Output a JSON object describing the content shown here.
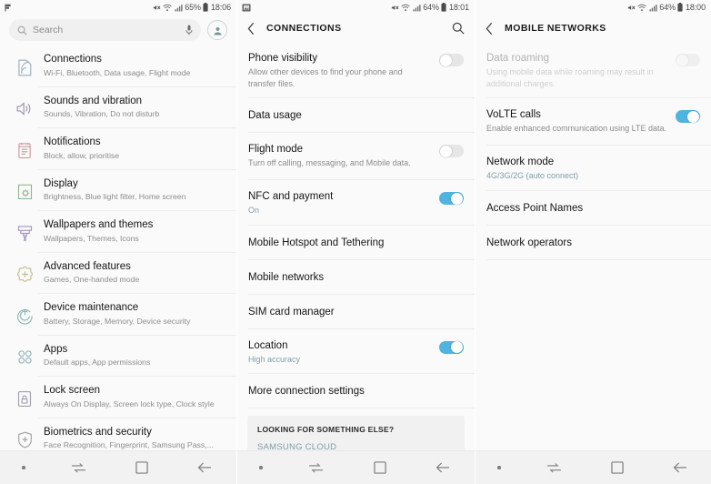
{
  "colors": {
    "accent_on": "#4fb4e0",
    "accent_link": "#7fa0a8",
    "bg": "#fafafa",
    "card_bg": "#f1f1f1",
    "title": "#151515",
    "subtitle": "#8c8c8c"
  },
  "panel1": {
    "statusbar": {
      "left_icons": [
        "flag-notification-icon"
      ],
      "mute_icon": "sound-mute-icon",
      "wifi_icon": "wifi-icon",
      "signal_icon": "signal-bars-icon",
      "battery_text": "65%",
      "battery_icon": "battery-icon",
      "time": "18:06"
    },
    "search": {
      "placeholder": "Search",
      "search_icon": "search-icon",
      "mic_icon": "microphone-icon",
      "avatar_icon": "account-avatar-icon"
    },
    "items": [
      {
        "icon": "connections-icon",
        "icon_color": "#9badbd",
        "title": "Connections",
        "subtitle": "Wi-Fi, Bluetooth, Data usage, Flight mode"
      },
      {
        "icon": "speaker-icon",
        "icon_color": "#9a94ad",
        "title": "Sounds and vibration",
        "subtitle": "Sounds, Vibration, Do not disturb"
      },
      {
        "icon": "notifications-icon",
        "icon_color": "#c99a9a",
        "title": "Notifications",
        "subtitle": "Block, allow, prioritise"
      },
      {
        "icon": "display-icon",
        "icon_color": "#8fb98f",
        "title": "Display",
        "subtitle": "Brightness, Blue light filter, Home screen"
      },
      {
        "icon": "paintbrush-icon",
        "icon_color": "#a695bd",
        "title": "Wallpapers and themes",
        "subtitle": "Wallpapers, Themes, Icons"
      },
      {
        "icon": "advanced-features-icon",
        "icon_color": "#c4bd86",
        "title": "Advanced features",
        "subtitle": "Games, One-handed mode"
      },
      {
        "icon": "device-maintenance-icon",
        "icon_color": "#8fb5b5",
        "title": "Device maintenance",
        "subtitle": "Battery, Storage, Memory, Device security"
      },
      {
        "icon": "apps-grid-icon",
        "icon_color": "#93b3b8",
        "title": "Apps",
        "subtitle": "Default apps, App permissions"
      },
      {
        "icon": "lock-icon",
        "icon_color": "#a0a0b0",
        "title": "Lock screen",
        "subtitle": "Always On Display, Screen lock type, Clock style"
      },
      {
        "icon": "shield-plus-icon",
        "icon_color": "#a3a3a3",
        "title": "Biometrics and security",
        "subtitle": "Face Recognition, Fingerprint, Samsung Pass,..."
      }
    ]
  },
  "panel2": {
    "statusbar": {
      "left_icons": [
        "screenshot-image-icon"
      ],
      "battery_text": "64%",
      "time": "18:01"
    },
    "header": {
      "back_icon": "back-chevron-icon",
      "title": "CONNECTIONS",
      "search_icon": "search-icon"
    },
    "items": [
      {
        "title": "Phone visibility",
        "subtitle": "Allow other devices to find your phone and transfer files.",
        "toggle": "off"
      },
      {
        "title": "Data usage",
        "subtitle": "",
        "toggle": "none"
      },
      {
        "title": "Flight mode",
        "subtitle": "Turn off calling, messaging, and Mobile data.",
        "toggle": "off"
      },
      {
        "title": "NFC and payment",
        "subtitle": "On",
        "subtitle_accent": true,
        "toggle": "on"
      },
      {
        "title": "Mobile Hotspot and Tethering",
        "subtitle": "",
        "toggle": "none"
      },
      {
        "title": "Mobile networks",
        "subtitle": "",
        "toggle": "none"
      },
      {
        "title": "SIM card manager",
        "subtitle": "",
        "toggle": "none"
      },
      {
        "title": "Location",
        "subtitle": "High accuracy",
        "subtitle_accent": true,
        "toggle": "on"
      },
      {
        "title": "More connection settings",
        "subtitle": "",
        "toggle": "none"
      }
    ],
    "card": {
      "heading": "LOOKING FOR SOMETHING ELSE?",
      "link": "SAMSUNG CLOUD"
    }
  },
  "panel3": {
    "statusbar": {
      "battery_text": "64%",
      "time": "18:00"
    },
    "header": {
      "back_icon": "back-chevron-icon",
      "title": "MOBILE NETWORKS"
    },
    "items": [
      {
        "title": "Data roaming",
        "subtitle": "Using mobile data while roaming may result in additional charges.",
        "toggle": "disabled",
        "dimmed": true
      },
      {
        "title": "VoLTE calls",
        "subtitle": "Enable enhanced communication using LTE data.",
        "toggle": "on"
      },
      {
        "title": "Network mode",
        "subtitle": "4G/3G/2G (auto connect)",
        "subtitle_accent": true,
        "toggle": "none"
      },
      {
        "title": "Access Point Names",
        "subtitle": "",
        "toggle": "none"
      },
      {
        "title": "Network operators",
        "subtitle": "",
        "toggle": "none"
      }
    ]
  },
  "navbar": {
    "dot": "recent-dot-indicator",
    "recents_icon": "recents-icon",
    "home_icon": "home-square-icon",
    "back_icon": "back-arrow-icon"
  }
}
